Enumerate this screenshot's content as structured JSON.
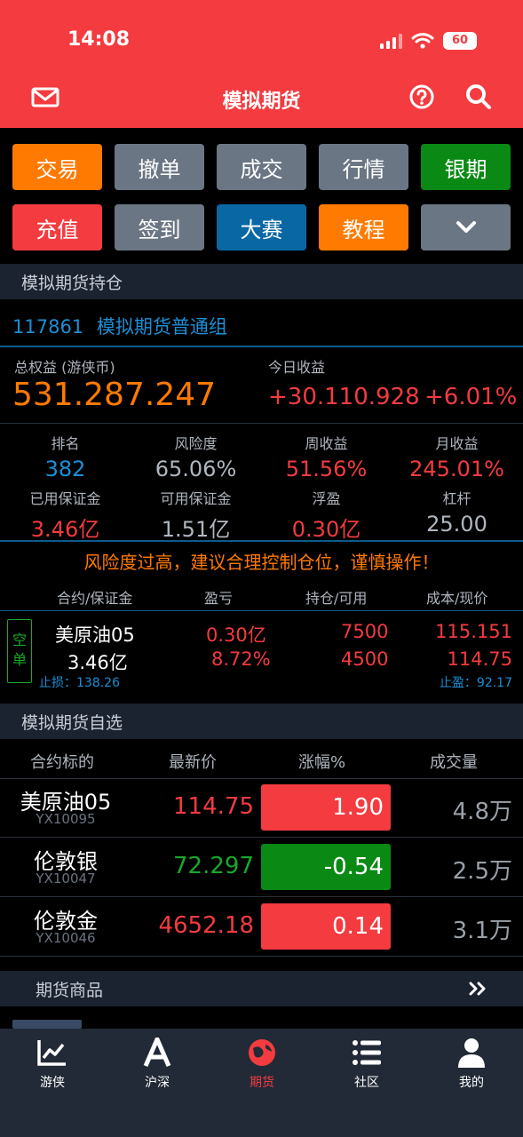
{
  "status": {
    "time": "14:08",
    "battery": "60"
  },
  "nav": {
    "title": "模拟期货"
  },
  "buttons": [
    {
      "label": "交易",
      "color": "#ff7a00"
    },
    {
      "label": "撤单",
      "color": "#6b7684"
    },
    {
      "label": "成交",
      "color": "#6b7684"
    },
    {
      "label": "行情",
      "color": "#6b7684"
    },
    {
      "label": "银期",
      "color": "#0a8a14"
    },
    {
      "label": "充值",
      "color": "#f43b3f"
    },
    {
      "label": "签到",
      "color": "#6b7684"
    },
    {
      "label": "大赛",
      "color": "#0967a4"
    },
    {
      "label": "教程",
      "color": "#ff7a00"
    }
  ],
  "holdings": {
    "section_title": "模拟期货持仓",
    "account_id": "117861",
    "group_name": "模拟期货普通组",
    "equity_label": "总权益 (游侠币)",
    "equity_value": "531.287.247",
    "today_label": "今日收益",
    "today_value": "+30.110.928",
    "today_pct": "+6.01%",
    "stats_row1": [
      {
        "label": "排名",
        "value": "382",
        "color": "blue"
      },
      {
        "label": "风险度",
        "value": "65.06%",
        "color": "gray"
      },
      {
        "label": "周收益",
        "value": "51.56%",
        "color": "red"
      },
      {
        "label": "月收益",
        "value": "245.01%",
        "color": "red"
      }
    ],
    "stats_row2": [
      {
        "label": "已用保证金",
        "value": "3.46亿",
        "color": "red"
      },
      {
        "label": "可用保证金",
        "value": "1.51亿",
        "color": "gray"
      },
      {
        "label": "浮盈",
        "value": "0.30亿",
        "color": "red"
      },
      {
        "label": "杠杆",
        "value": "25.00",
        "color": "gray"
      }
    ],
    "warning": "风险度过高，建议合理控制仓位，谨慎操作！",
    "table_headers": [
      "合约/保证金",
      "盈亏",
      "持仓/可用",
      "成本/现价"
    ],
    "position": {
      "tag": "空单",
      "contract": "美原油05",
      "margin": "3.46亿",
      "stop_loss": "止损：138.26",
      "pnl": "0.30亿",
      "pnl_pct": "8.72%",
      "hold": "7500",
      "avail": "4500",
      "cost": "115.151",
      "price": "114.75",
      "take_profit": "止盈：92.17"
    }
  },
  "watchlist": {
    "section_title": "模拟期货自选",
    "headers": [
      "合约标的",
      "最新价",
      "涨幅%",
      "成交量"
    ],
    "rows": [
      {
        "name": "美原油05",
        "code": "YX10095",
        "price": "114.75",
        "change": "1.90",
        "volume": "4.8万",
        "up": true
      },
      {
        "name": "伦敦银",
        "code": "YX10047",
        "price": "72.297",
        "change": "-0.54",
        "volume": "2.5万",
        "up": false
      },
      {
        "name": "伦敦金",
        "code": "YX10046",
        "price": "4652.18",
        "change": "0.14",
        "volume": "3.1万",
        "up": true
      }
    ]
  },
  "products": {
    "section_title": "期货商品"
  },
  "tabs": [
    {
      "label": "游侠",
      "icon": "chart-line-icon",
      "active": false
    },
    {
      "label": "沪深",
      "icon": "letter-a-icon",
      "active": false
    },
    {
      "label": "期货",
      "icon": "globe-icon",
      "active": true
    },
    {
      "label": "社区",
      "icon": "list-icon",
      "active": false
    },
    {
      "label": "我的",
      "icon": "user-icon",
      "active": false
    }
  ],
  "colors": {
    "brand_red": "#f43b3f",
    "up_red": "#f43b3f",
    "down_green": "#0a8a14",
    "accent_orange": "#ff7a00",
    "link_blue": "#1c8fd6"
  }
}
